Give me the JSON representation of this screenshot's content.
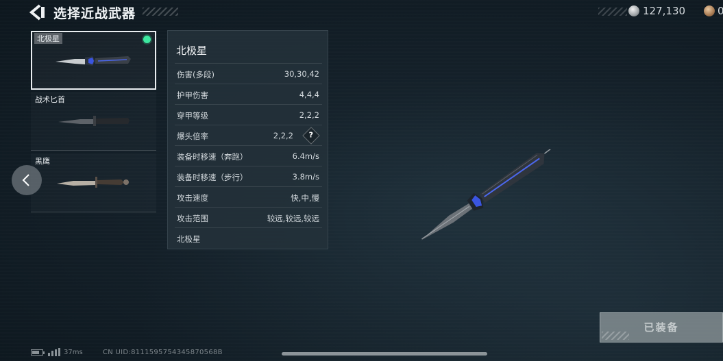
{
  "header": {
    "title": "选择近战武器",
    "currency": [
      {
        "icon": "silver-coin-icon",
        "value": "127,130"
      },
      {
        "icon": "bronze-coin-icon",
        "value": "0"
      }
    ]
  },
  "weapons": [
    {
      "name": "北极星",
      "selected": true,
      "equipped": true
    },
    {
      "name": "战术匕首",
      "selected": false,
      "equipped": false
    },
    {
      "name": "黑鹰",
      "selected": false,
      "equipped": false
    }
  ],
  "stats": {
    "title": "北极星",
    "rows": [
      {
        "label": "伤害(多段)",
        "value": "30,30,42"
      },
      {
        "label": "护甲伤害",
        "value": "4,4,4"
      },
      {
        "label": "穿甲等级",
        "value": "2,2,2"
      },
      {
        "label": "爆头倍率",
        "value": "2,2,2",
        "help": "?"
      },
      {
        "label": "装备时移速（奔跑）",
        "value": "6.4m/s"
      },
      {
        "label": "装备时移速（步行）",
        "value": "3.8m/s"
      },
      {
        "label": "攻击速度",
        "value": "快,中,慢"
      },
      {
        "label": "攻击范围",
        "value": "较远,较远,较远"
      },
      {
        "label": "北极星",
        "value": ""
      }
    ]
  },
  "equip_button": {
    "label": "已装备"
  },
  "footer": {
    "latency": "37ms",
    "uid": "CN UID:8111595754345870568B"
  },
  "colors": {
    "equipped_indicator": "#3de8a0",
    "knife_accent": "#3a55e0"
  }
}
